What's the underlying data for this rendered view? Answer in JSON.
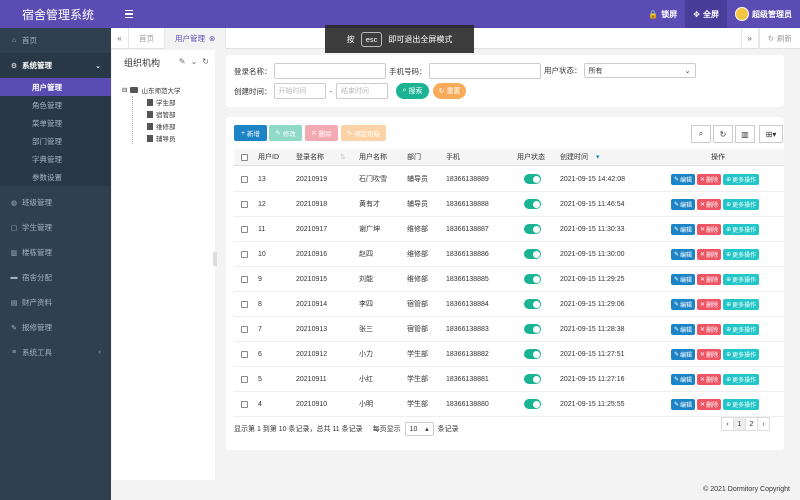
{
  "app": {
    "title": "宿舍管理系统"
  },
  "header": {
    "lock_label": "锁屏",
    "fullscreen_label": "全屏",
    "user_label": "超级管理员"
  },
  "toast": {
    "prefix": "按",
    "key": "esc",
    "suffix": "即可退出全屏模式"
  },
  "sidebar": {
    "home": "首页",
    "system": "系统管理",
    "sub_items": [
      "用户管理",
      "角色管理",
      "菜单管理",
      "部门管理",
      "字典管理",
      "参数设置"
    ],
    "items": [
      "班级管理",
      "学生管理",
      "楼栋管理",
      "宿舍分配",
      "财产资料",
      "报修管理",
      "系统工具"
    ]
  },
  "tabs": {
    "home": "首页",
    "active": "用户管理",
    "refresh": "刷新"
  },
  "org": {
    "title": "组织机构",
    "root": "山东师范大学",
    "children": [
      "学生部",
      "宿管部",
      "维修部",
      "辅导员"
    ]
  },
  "search": {
    "login_label": "登录名称：",
    "phone_label": "手机号码：",
    "status_label": "用户状态：",
    "status_value": "所有",
    "created_label": "创建时间：",
    "start_placeholder": "开始时间",
    "end_placeholder": "结束时间",
    "dash": "-",
    "search_btn": "搜索",
    "reset_btn": "重置"
  },
  "toolbar": {
    "add": "新增",
    "edit": "修改",
    "delete": "删除",
    "assign": "绑定班级"
  },
  "table": {
    "headers": [
      "用户ID",
      "登录名称",
      "用户名称",
      "部门",
      "手机",
      "用户状态",
      "创建时间",
      "操作"
    ],
    "actions": {
      "edit": "编辑",
      "delete": "删除",
      "more": "更多操作"
    },
    "rows": [
      {
        "id": "13",
        "login": "20210919",
        "name": "石门吹雪",
        "dept": "辅导员",
        "phone": "18366138889",
        "created": "2021-09-15 14:42:08"
      },
      {
        "id": "12",
        "login": "20210918",
        "name": "黄有才",
        "dept": "辅导员",
        "phone": "18366138888",
        "created": "2021-09-15 11:46:54"
      },
      {
        "id": "11",
        "login": "20210917",
        "name": "谢广坤",
        "dept": "维修部",
        "phone": "18366138887",
        "created": "2021-09-15 11:30:33"
      },
      {
        "id": "10",
        "login": "20210916",
        "name": "赵四",
        "dept": "维修部",
        "phone": "18366138886",
        "created": "2021-09-15 11:30:00"
      },
      {
        "id": "9",
        "login": "20210915",
        "name": "刘能",
        "dept": "维修部",
        "phone": "18366138885",
        "created": "2021-09-15 11:29:25"
      },
      {
        "id": "8",
        "login": "20210914",
        "name": "李四",
        "dept": "宿管部",
        "phone": "18366138884",
        "created": "2021-09-15 11:29:06"
      },
      {
        "id": "7",
        "login": "20210913",
        "name": "张三",
        "dept": "宿管部",
        "phone": "18366138883",
        "created": "2021-09-15 11:28:38"
      },
      {
        "id": "6",
        "login": "20210912",
        "name": "小力",
        "dept": "学生部",
        "phone": "18366138882",
        "created": "2021-09-15 11:27:51"
      },
      {
        "id": "5",
        "login": "20210911",
        "name": "小红",
        "dept": "学生部",
        "phone": "18366138881",
        "created": "2021-09-15 11:27:16"
      },
      {
        "id": "4",
        "login": "20210910",
        "name": "小明",
        "dept": "学生部",
        "phone": "18366138880",
        "created": "2021-09-15 11:25:55"
      }
    ]
  },
  "pagination": {
    "summary": "显示第 1 到第 10 条记录，总共 11 条记录",
    "per_page_label": "每页显示",
    "per_page_value": "10",
    "per_page_suffix": "条记录",
    "prev": "‹",
    "pages": [
      "1",
      "2"
    ],
    "next": "›"
  },
  "footer": {
    "copyright": "© 2021 Dormitory Copyright"
  },
  "colors": {
    "brand": "#5b4cb3",
    "sidebar": "#2f4050",
    "primary": "#1c84c6",
    "success": "#1ab394",
    "danger": "#ed5565",
    "warning": "#f8ac59",
    "info": "#23c6c8"
  }
}
